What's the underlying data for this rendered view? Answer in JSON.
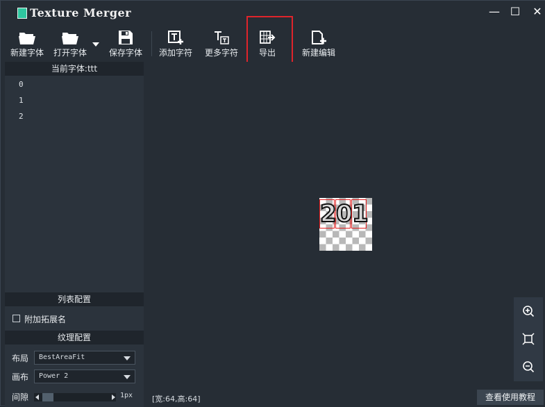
{
  "window": {
    "title": "Texture Merger",
    "minimize": "—",
    "maximize": "☐",
    "close": "✕"
  },
  "toolbar": {
    "new_font": "新建字体",
    "open_font": "打开字体",
    "save_font": "保存字体",
    "add_chars": "添加字符",
    "more_chars": "更多字符",
    "export": "导出",
    "new_edit": "新建编辑"
  },
  "sidebar": {
    "current_font": "当前字体:ttt",
    "items": [
      "0",
      "1",
      "2"
    ],
    "list_config": "列表配置",
    "append_ext": "附加拓展名",
    "texture_config": "纹理配置",
    "layout_label": "布局",
    "layout_value": "BestAreaFit",
    "canvas_label": "画布",
    "canvas_value": "Power 2",
    "gap_label": "间隙",
    "gap_value": "1px"
  },
  "canvas": {
    "glyphs": [
      "2",
      "0",
      "1"
    ]
  },
  "status": {
    "size_text": "[宽:64,高:64]",
    "help_button": "查看使用教程"
  },
  "colors": {
    "background": "#262d35",
    "highlight": "#e0242b",
    "accent_icon": "#2fc7a0"
  },
  "icons": [
    "folder-icon",
    "save-icon",
    "add-text-icon",
    "more-text-icon",
    "export-icon",
    "new-edit-icon",
    "zoom-in-icon",
    "fit-icon",
    "zoom-out-icon"
  ]
}
